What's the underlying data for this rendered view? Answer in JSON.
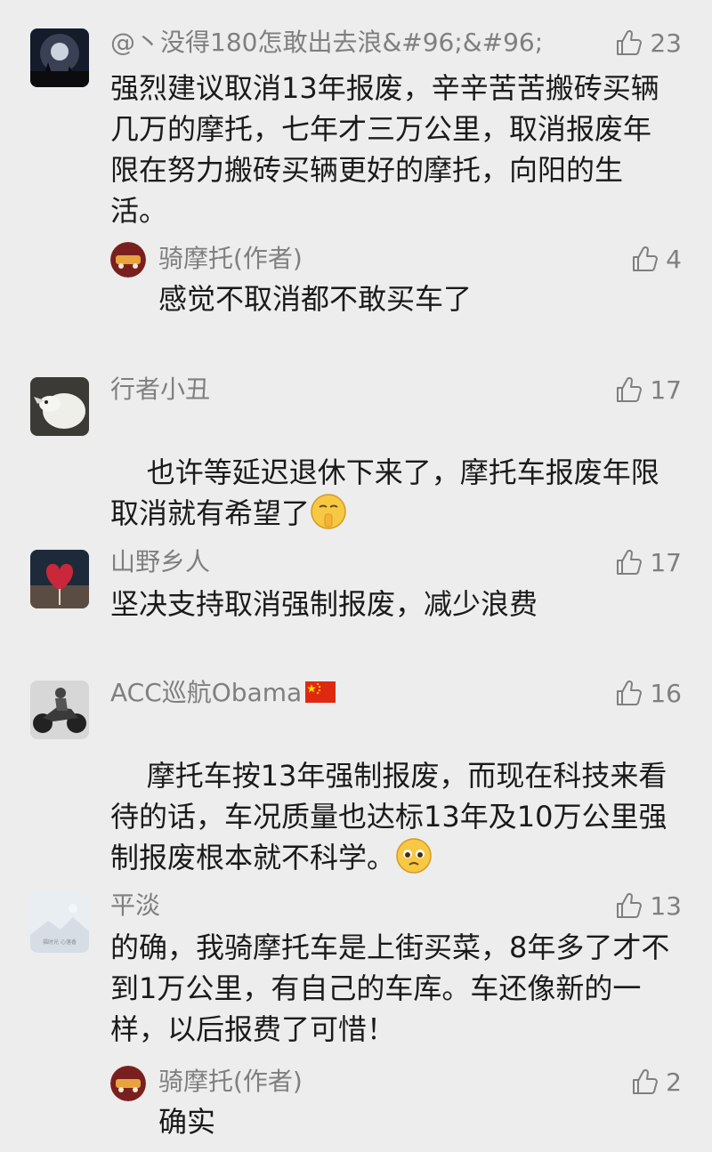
{
  "comments": [
    {
      "author": "@丶没得180怎敢出去浪&#96;&#96;",
      "likes": "23",
      "text": "强烈建议取消13年报废，辛辛苦苦搬砖买辆几万的摩托，七年才三万公里，取消报废年限在努力搬砖买辆更好的摩托，向阳的生活。",
      "reply": {
        "author": "骑摩托(作者)",
        "likes": "4",
        "text": "感觉不取消都不敢买车了"
      }
    },
    {
      "author": "行者小丑",
      "likes": "17",
      "text": "也许等延迟退休下来了，摩托车报废年限取消就有希望了"
    },
    {
      "author": "山野乡人",
      "likes": "17",
      "text": "坚决支持取消强制报废，减少浪费"
    },
    {
      "author": "ACC巡航Obama",
      "likes": "16",
      "text": "摩托车按13年强制报废，而现在科技来看待的话，车况质量也达标13年及10万公里强制报废根本就不科学。"
    },
    {
      "author": "平淡",
      "likes": "13",
      "avatar_caption": "福时光 心落香",
      "text": "的确，我骑摩托车是上街买菜，8年多了才不到1万公里，有自己的车库。车还像新的一样，以后报费了可惜！",
      "reply": {
        "author": "骑摩托(作者)",
        "likes": "2",
        "text": "确实"
      }
    }
  ],
  "icons": {
    "like": "thumbs-up-icon",
    "emoji_shush": "shushing-face-icon",
    "emoji_pleading": "pleading-face-icon",
    "flag": "china-flag-icon"
  },
  "colors": {
    "background": "#ededed",
    "meta_text": "#7f7f7f",
    "body_text": "#1a1a1a"
  }
}
